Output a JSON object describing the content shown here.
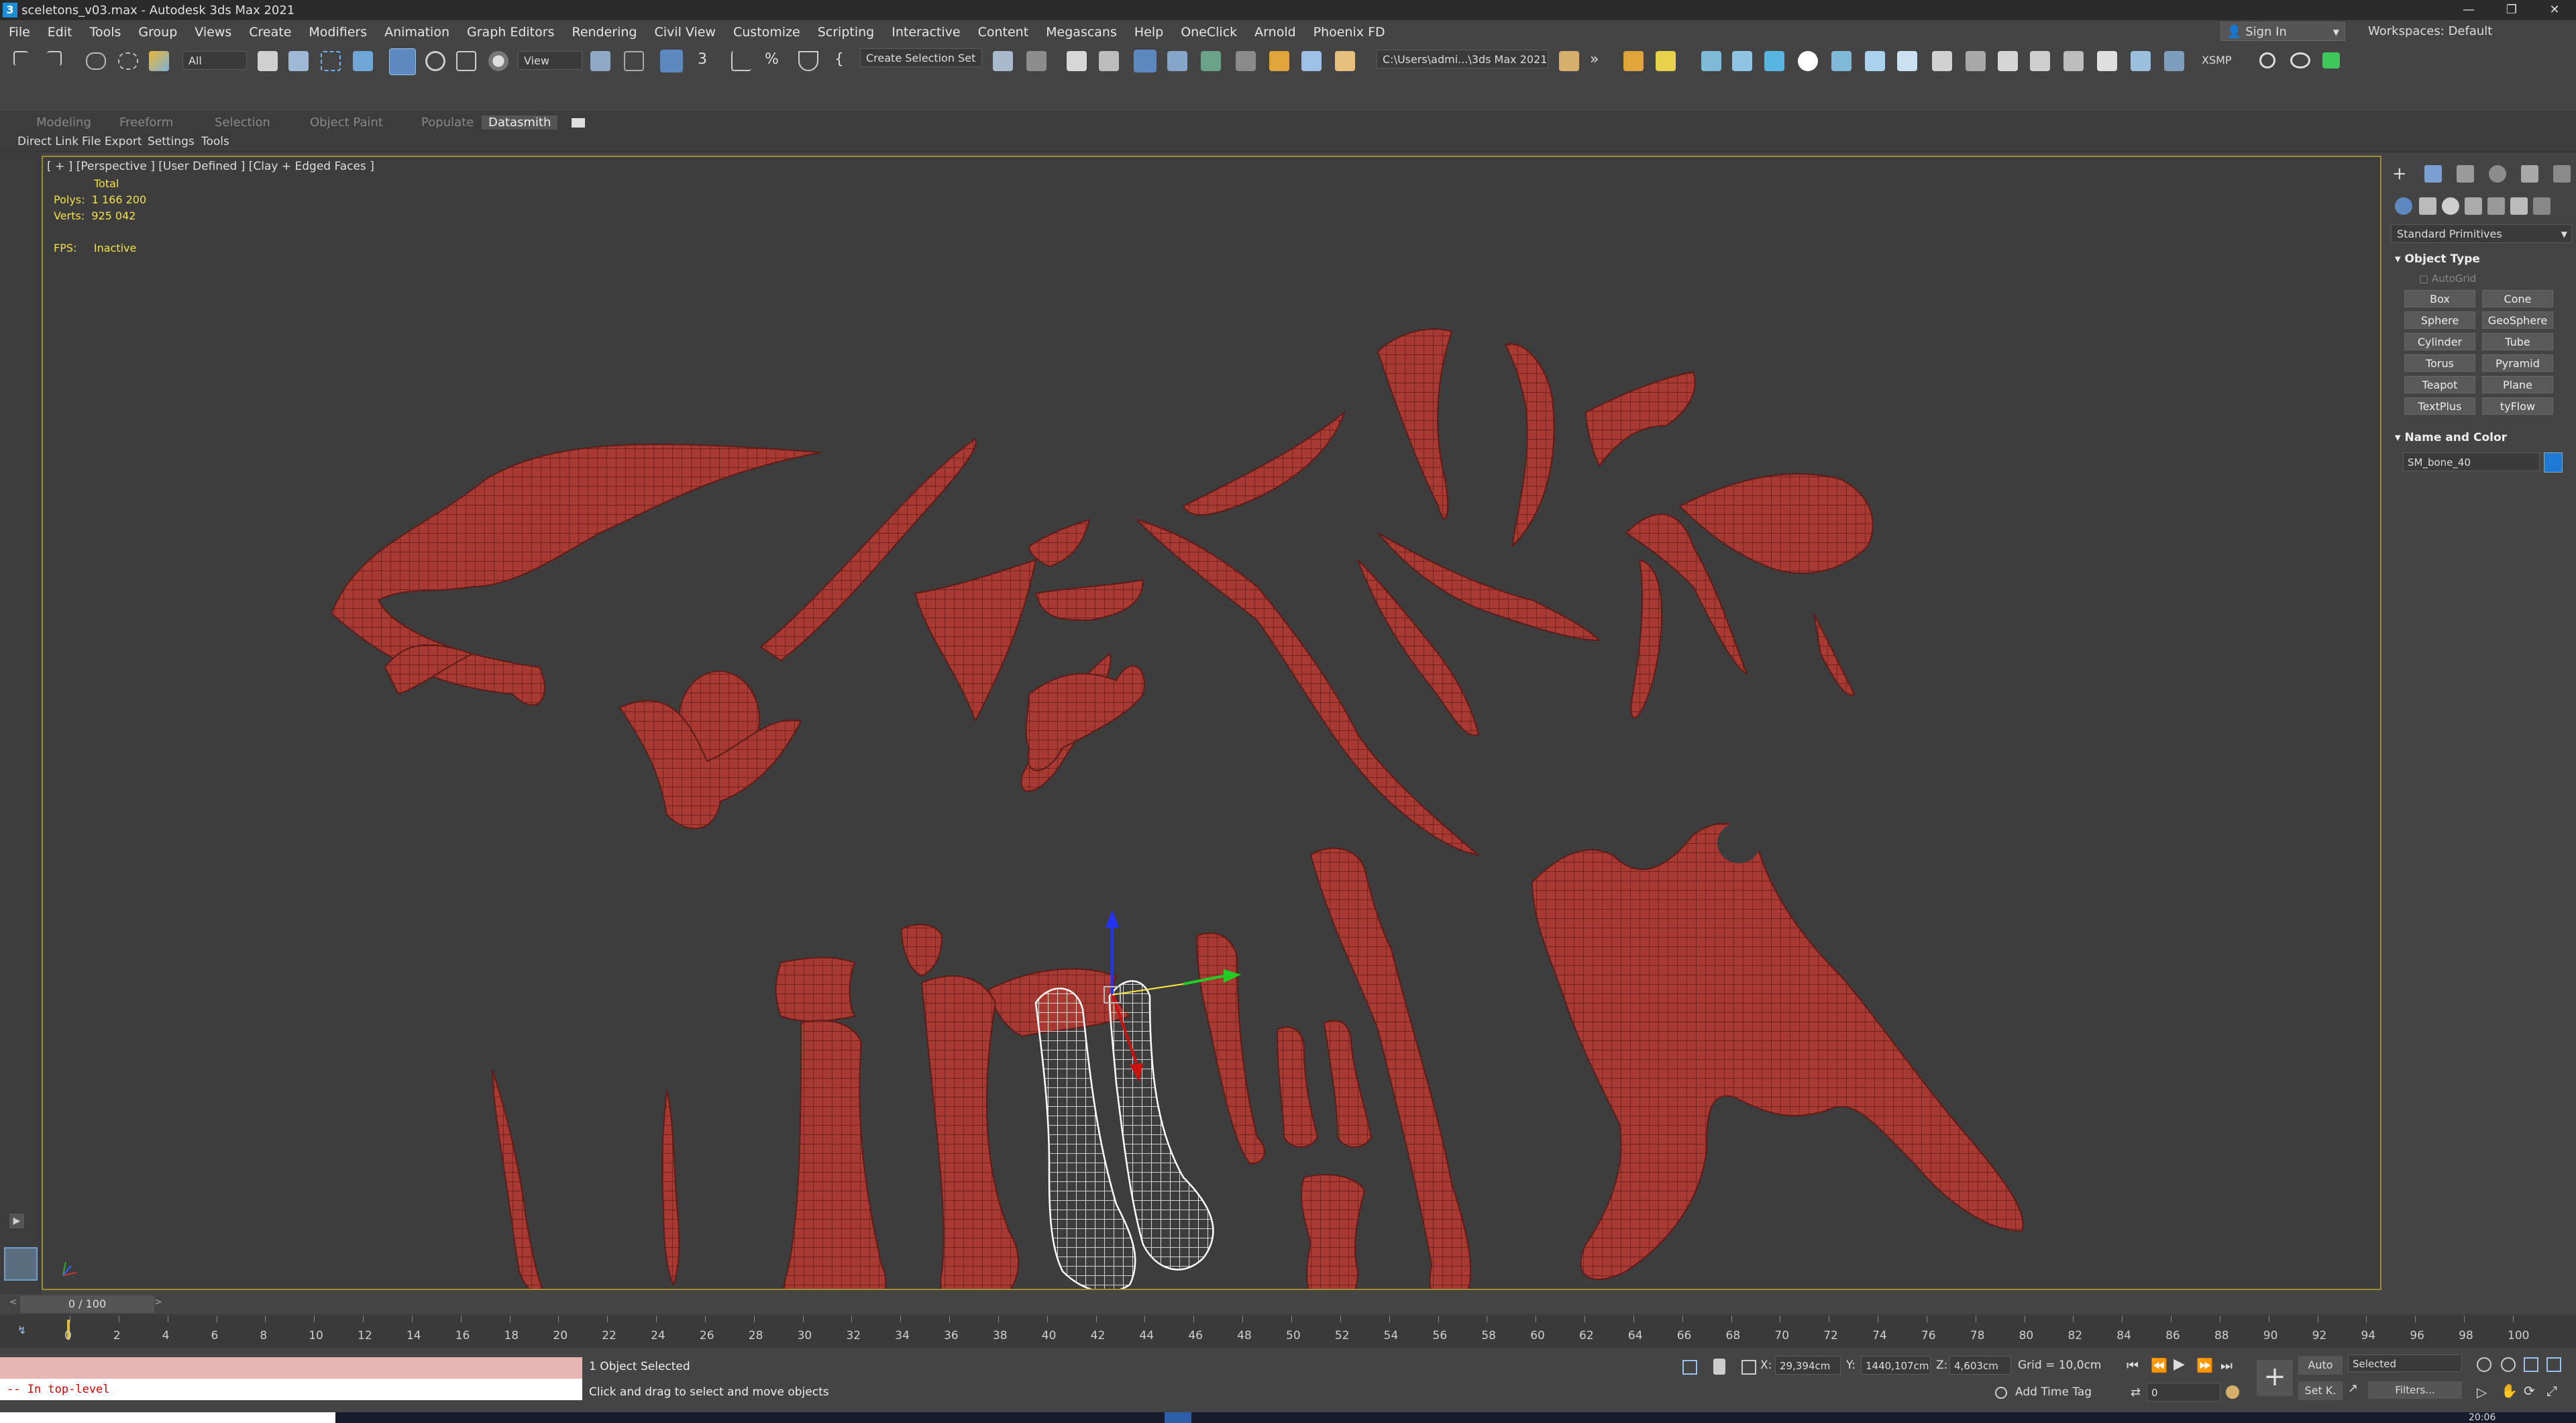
{
  "window": {
    "title": "sceletons_v03.max - Autodesk 3ds Max 2021",
    "controls": {
      "minimize": "—",
      "maximize": "❐",
      "close": "✕"
    }
  },
  "menu": [
    "File",
    "Edit",
    "Tools",
    "Group",
    "Views",
    "Create",
    "Modifiers",
    "Animation",
    "Graph Editors",
    "Rendering",
    "Civil View",
    "Customize",
    "Scripting",
    "Interactive",
    "Content",
    "Megascans",
    "Help",
    "OneClick",
    "Arnold",
    "Phoenix FD"
  ],
  "signin": {
    "label": "Sign In"
  },
  "workspaces": {
    "label": "Workspaces:",
    "value": "Default"
  },
  "toolbar": {
    "selection_filter": "All",
    "ref_coord": "View",
    "named_selection": "Create Selection Set",
    "path": "C:\\Users\\admi...\\3ds Max 2021",
    "xsmp": "XSMP"
  },
  "ribbon": {
    "tabs": [
      "Modeling",
      "Freeform",
      "Selection",
      "Object Paint",
      "Populate",
      "Datasmith"
    ],
    "active": "Datasmith",
    "subtabs": [
      "Direct Link",
      "File Export",
      "Settings",
      "Tools"
    ]
  },
  "viewport": {
    "label": "[ + ] [Perspective ] [User Defined ] [Clay + Edged Faces ]",
    "stats": {
      "total_label": "Total",
      "polys_label": "Polys:",
      "polys": "1 166 200",
      "verts_label": "Verts:",
      "verts": "925 042",
      "fps_label": "FPS:",
      "fps": "Inactive"
    },
    "bone_color": "#a83a33",
    "selected_color": "#ffffff",
    "background": "#3d3d3d"
  },
  "command_panel": {
    "category": "Standard Primitives",
    "object_type_title": "Object Type",
    "autogrid": "AutoGrid",
    "buttons": [
      "Box",
      "Cone",
      "Sphere",
      "GeoSphere",
      "Cylinder",
      "Tube",
      "Torus",
      "Pyramid",
      "Teapot",
      "Plane",
      "TextPlus",
      "tyFlow"
    ],
    "name_color_title": "Name and Color",
    "object_name": "SM_bone_40",
    "object_color": "#1f7ad6"
  },
  "timeline": {
    "frame": "0 / 100",
    "ticks": [
      "0",
      "2",
      "4",
      "6",
      "8",
      "10",
      "12",
      "14",
      "16",
      "18",
      "20",
      "22",
      "24",
      "26",
      "28",
      "30",
      "32",
      "34",
      "36",
      "38",
      "40",
      "42",
      "44",
      "46",
      "48",
      "50",
      "52",
      "54",
      "56",
      "58",
      "60",
      "62",
      "64",
      "66",
      "68",
      "70",
      "72",
      "74",
      "76",
      "78",
      "80",
      "82",
      "84",
      "86",
      "88",
      "90",
      "92",
      "94",
      "96",
      "98",
      "100"
    ]
  },
  "status": {
    "selection": "1 Object Selected",
    "prompt": "Click and drag to select and move objects",
    "maxscript": "-- In top-level",
    "x_label": "X:",
    "x": "29,394cm",
    "y_label": "Y:",
    "y": "1440,107cm",
    "z_label": "Z:",
    "z": "4,603cm",
    "grid": "Grid = 10,0cm",
    "add_time_tag": "Add Time Tag",
    "auto": "Auto",
    "set_key": "Set K.",
    "key_filter": "Selected",
    "filters": "Filters...",
    "frame_field": "0",
    "clock": "20:06"
  }
}
